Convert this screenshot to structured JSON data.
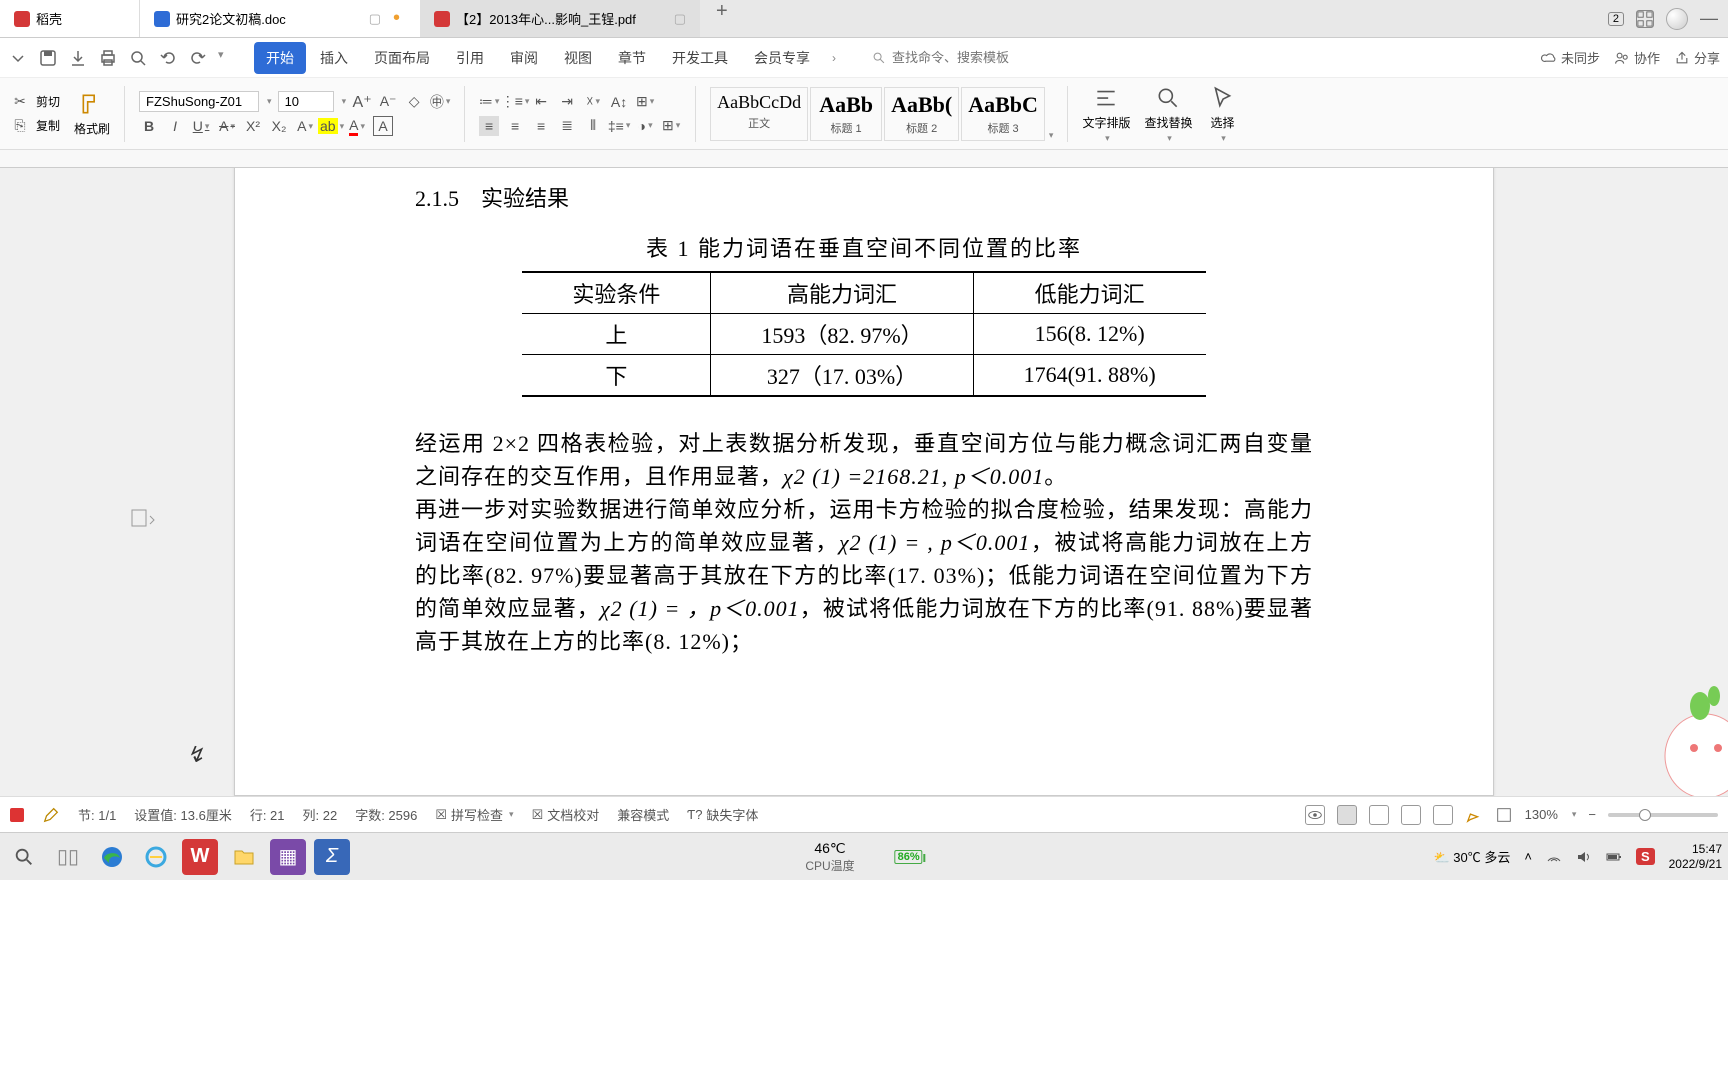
{
  "tabs": {
    "app": "稻壳",
    "active": "研究2论文初稿.doc",
    "inactive": "【2】2013年心...影响_王锃.pdf",
    "windowCount": "2"
  },
  "menu": {
    "items": [
      "开始",
      "插入",
      "页面布局",
      "引用",
      "审阅",
      "视图",
      "章节",
      "开发工具",
      "会员专享"
    ],
    "searchPlaceholder": "查找命令、搜索模板",
    "sync": "未同步",
    "collab": "协作",
    "share": "分享"
  },
  "ribbon": {
    "cut": "剪切",
    "copy": "复制",
    "formatPainter": "格式刷",
    "fontName": "FZShuSong-Z01",
    "fontSize": "10",
    "styles": [
      {
        "preview": "AaBbCcDd",
        "label": "正文",
        "big": false
      },
      {
        "preview": "AaBb",
        "label": "标题 1",
        "big": true
      },
      {
        "preview": "AaBb(",
        "label": "标题 2",
        "big": true
      },
      {
        "preview": "AaBbC",
        "label": "标题 3",
        "big": true
      }
    ],
    "textLayout": "文字排版",
    "findReplace": "查找替换",
    "select": "选择"
  },
  "document": {
    "sectionHeading": "2.1.5　实验结果",
    "tableCaption": "表 1 能力词语在垂直空间不同位置的比率",
    "table": {
      "headers": [
        "实验条件",
        "高能力词汇",
        "低能力词汇"
      ],
      "rows": [
        [
          "上",
          "1593（82. 97%）",
          "156(8. 12%)"
        ],
        [
          "下",
          "327（17. 03%）",
          "1764(91. 88%)"
        ]
      ]
    },
    "para1a": "经运用 2×2 四格表检验，对上表数据分析发现，垂直空间方位与能力概念词汇两自变量之间存在的交互作用，且作用显著，",
    "chi1": "χ2 (1) =2168.21, p＜0.001",
    "para1b": "。",
    "para2a": "再进一步对实验数据进行简单效应分析，运用卡方检验的拟合度检验，结果发现：高能力词语在空间位置为上方的简单效应显著，",
    "chi2": "χ2 (1) = , p＜0.001",
    "para2b": "，被试将高能力词放在上方的比率(82. 97%)要显著高于其放在下方的比率(17. 03%)；低能力词语在空间位置为下方的简单效应显著，",
    "chi3": "χ2 (1) =  ，p＜0.001",
    "para2c": "，被试将低能力词放在下方的比率(91. 88%)要显著高于其放在上方的比率(8. 12%)；"
  },
  "chart_data": {
    "type": "table",
    "title": "表 1 能力词语在垂直空间不同位置的比率",
    "columns": [
      "实验条件",
      "高能力词汇 count",
      "高能力词汇 %",
      "低能力词汇 count",
      "低能力词汇 %"
    ],
    "rows": [
      {
        "condition": "上",
        "high_count": 1593,
        "high_pct": 82.97,
        "low_count": 156,
        "low_pct": 8.12
      },
      {
        "condition": "下",
        "high_count": 327,
        "high_pct": 17.03,
        "low_count": 1764,
        "low_pct": 91.88
      }
    ],
    "chi_square_interaction": {
      "df": 1,
      "value": 2168.21,
      "p": "<0.001"
    }
  },
  "status": {
    "section": "节: 1/1",
    "setting": "设置值: 13.6厘米",
    "line": "行: 21",
    "col": "列: 22",
    "words": "字数: 2596",
    "spellCheck": "拼写检查",
    "docCheck": "文档校对",
    "compat": "兼容模式",
    "missingFont": "缺失字体",
    "zoom": "130%"
  },
  "taskbar": {
    "appsLabel": "",
    "cpuTemp": "46℃",
    "cpuLabel": "CPU温度",
    "battery": "86%",
    "weather": "30℃ 多云",
    "ime": "S",
    "time": "15:47",
    "date": "2022/9/21"
  }
}
